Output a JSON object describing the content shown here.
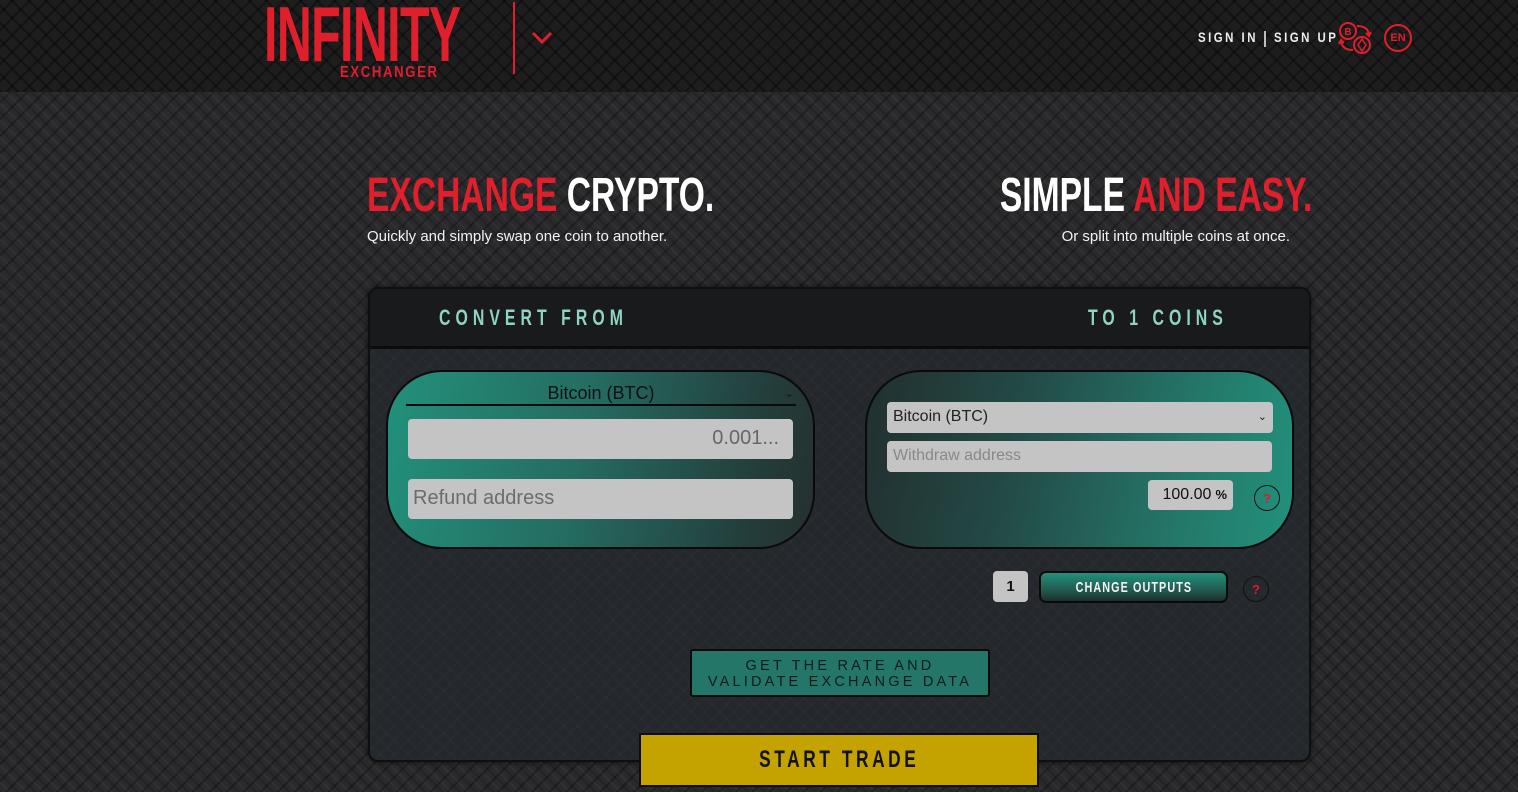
{
  "header": {
    "logo_main": "INFINITY",
    "logo_sub": "EXCHANGER",
    "sign_in": "SIGN IN",
    "sign_up": "SIGN UP",
    "language": "EN",
    "icons": {
      "menu": "chevron-down-icon",
      "exchange": "crypto-exchange-icon"
    }
  },
  "hero": {
    "left": {
      "title_red": "EXCHANGE",
      "title_white": "CRYPTO.",
      "subtitle": "Quickly and simply swap one coin to another."
    },
    "right": {
      "title_white": "SIMPLE",
      "title_red": "AND EASY.",
      "subtitle": "Or split into multiple coins at once."
    }
  },
  "converter": {
    "from_label": "CONVERT FROM",
    "to_label": "TO 1 COINS",
    "from": {
      "coin_selected": "Bitcoin (BTC)",
      "amount_value": "0.001...",
      "refund_placeholder": "Refund address"
    },
    "to": {
      "coin_selected": "Bitcoin (BTC)",
      "withdraw_placeholder": "Withdraw address",
      "percent_value": "100.00",
      "percent_symbol": "%",
      "help": "?"
    },
    "outputs_count": "1",
    "change_outputs_label": "CHANGE OUTPUTS",
    "outputs_help": "?",
    "rate_button_line1": "GET THE RATE AND",
    "rate_button_line2": "VALIDATE EXCHANGE DATA",
    "start_trade_label": "START TRADE"
  },
  "colors": {
    "brand_red": "#e01f2d",
    "teal": "#22917b",
    "label_teal": "#8fd3c4",
    "start_yellow": "#c4a300"
  }
}
